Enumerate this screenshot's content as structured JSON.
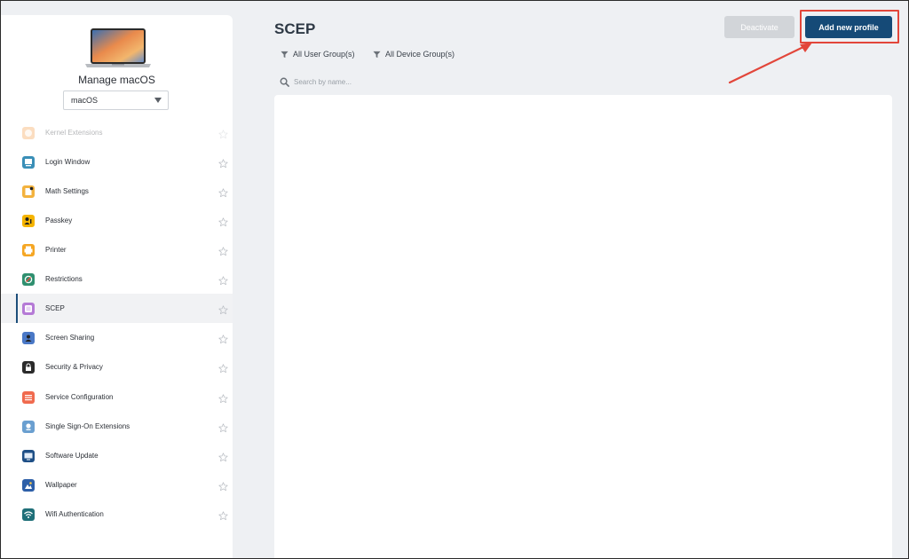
{
  "sidebar": {
    "title": "Manage macOS",
    "os_select": {
      "value": "macOS"
    },
    "items": [
      {
        "label": "Kernel Extensions",
        "icon": "kernel-extensions-icon",
        "color": "#f6a04d",
        "faded": true
      },
      {
        "label": "Login Window",
        "icon": "login-window-icon",
        "color": "#3a8fb7"
      },
      {
        "label": "Math Settings",
        "icon": "math-settings-icon",
        "color": "#f3b23e"
      },
      {
        "label": "Passkey",
        "icon": "passkey-icon",
        "color": "#f5b400"
      },
      {
        "label": "Printer",
        "icon": "printer-icon",
        "color": "#f5a623"
      },
      {
        "label": "Restrictions",
        "icon": "restrictions-icon",
        "color": "#2f8f6f"
      },
      {
        "label": "SCEP",
        "icon": "scep-icon",
        "color": "#b57ad6",
        "active": true
      },
      {
        "label": "Screen Sharing",
        "icon": "screen-sharing-icon",
        "color": "#4a78c6"
      },
      {
        "label": "Security & Privacy",
        "icon": "security-privacy-icon",
        "color": "#2b2b2b"
      },
      {
        "label": "Service Configuration",
        "icon": "service-configuration-icon",
        "color": "#f06a4e"
      },
      {
        "label": "Single Sign-On Extensions",
        "icon": "single-sign-on-icon",
        "color": "#6a9fd0"
      },
      {
        "label": "Software Update",
        "icon": "software-update-icon",
        "color": "#1e4f86"
      },
      {
        "label": "Wallpaper",
        "icon": "wallpaper-icon",
        "color": "#2d5fa8"
      },
      {
        "label": "Wifi Authentication",
        "icon": "wifi-authentication-icon",
        "color": "#1f6f78"
      }
    ]
  },
  "main": {
    "title": "SCEP",
    "deactivate_label": "Deactivate",
    "add_label": "Add new profile",
    "filters": {
      "user_groups": "All User Group(s)",
      "device_groups": "All Device Group(s)"
    },
    "search": {
      "placeholder": "Search by name..."
    }
  },
  "colors": {
    "primary": "#154a77",
    "highlight": "#e2463a",
    "disabled": "#d2d5d9"
  }
}
